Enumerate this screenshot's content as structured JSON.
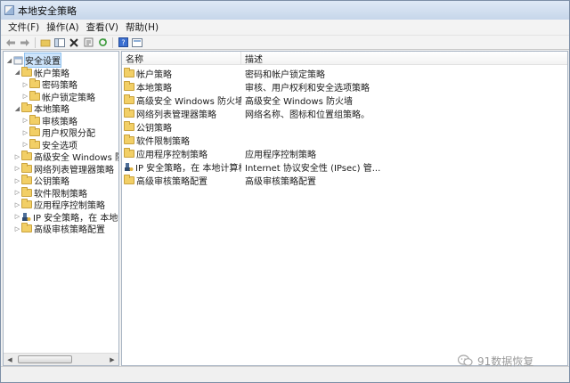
{
  "window": {
    "title": "本地安全策略"
  },
  "menu": [
    "文件(F)",
    "操作(A)",
    "查看(V)",
    "帮助(H)"
  ],
  "toolbar": {
    "buttons": [
      "back-icon",
      "forward-icon",
      "up-folder-icon",
      "show-tree-icon",
      "delete-icon",
      "properties-icon",
      "refresh-icon",
      "help-icon",
      "console-icon"
    ]
  },
  "tree": {
    "items": [
      {
        "label": "安全设置",
        "level": 0,
        "expanded": true,
        "icon": "shield-icon",
        "selected": true
      },
      {
        "label": "帐户策略",
        "level": 1,
        "expanded": true,
        "icon": "folder-icon"
      },
      {
        "label": "密码策略",
        "level": 2,
        "expanded": false,
        "icon": "folder-icon"
      },
      {
        "label": "帐户锁定策略",
        "level": 2,
        "expanded": false,
        "icon": "folder-icon"
      },
      {
        "label": "本地策略",
        "level": 1,
        "expanded": true,
        "icon": "folder-icon"
      },
      {
        "label": "审核策略",
        "level": 2,
        "expanded": false,
        "icon": "folder-icon"
      },
      {
        "label": "用户权限分配",
        "level": 2,
        "expanded": false,
        "icon": "folder-icon"
      },
      {
        "label": "安全选项",
        "level": 2,
        "expanded": false,
        "icon": "folder-icon"
      },
      {
        "label": "高级安全 Windows 防火墙",
        "level": 1,
        "expanded": false,
        "icon": "folder-icon"
      },
      {
        "label": "网络列表管理器策略",
        "level": 1,
        "expanded": false,
        "icon": "folder-icon"
      },
      {
        "label": "公钥策略",
        "level": 1,
        "expanded": false,
        "icon": "folder-icon"
      },
      {
        "label": "软件限制策略",
        "level": 1,
        "expanded": false,
        "icon": "folder-icon"
      },
      {
        "label": "应用程序控制策略",
        "level": 1,
        "expanded": false,
        "icon": "folder-icon"
      },
      {
        "label": "IP 安全策略，在 本地计算机",
        "level": 1,
        "expanded": false,
        "icon": "ipsec-icon"
      },
      {
        "label": "高级审核策略配置",
        "level": 1,
        "expanded": false,
        "icon": "folder-icon"
      }
    ]
  },
  "list": {
    "columns": [
      "名称",
      "描述"
    ],
    "rows": [
      {
        "name": "帐户策略",
        "description": "密码和帐户锁定策略",
        "icon": "folder-icon"
      },
      {
        "name": "本地策略",
        "description": "审核、用户权利和安全选项策略",
        "icon": "folder-icon"
      },
      {
        "name": "高级安全 Windows 防火墙",
        "description": "高级安全 Windows 防火墙",
        "icon": "folder-icon"
      },
      {
        "name": "网络列表管理器策略",
        "description": "网络名称、图标和位置组策略。",
        "icon": "folder-icon"
      },
      {
        "name": "公钥策略",
        "description": "",
        "icon": "folder-icon"
      },
      {
        "name": "软件限制策略",
        "description": "",
        "icon": "folder-icon"
      },
      {
        "name": "应用程序控制策略",
        "description": "应用程序控制策略",
        "icon": "folder-icon"
      },
      {
        "name": "IP 安全策略，在 本地计算机",
        "description": "Internet 协议安全性 (IPsec) 管...",
        "icon": "ipsec-icon"
      },
      {
        "name": "高级审核策略配置",
        "description": "高级审核策略配置",
        "icon": "folder-icon"
      }
    ]
  },
  "watermark": {
    "text": "91数据恢复"
  }
}
